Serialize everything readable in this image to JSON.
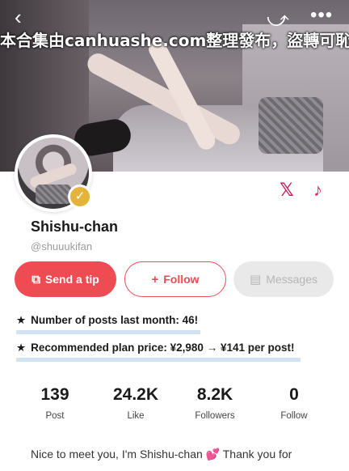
{
  "watermark": "本合集由canhuashe.com整理發布，盜轉可恥",
  "topbar": {
    "back_icon": "‹",
    "share_icon": "⤻",
    "more_icon": "•••"
  },
  "profile": {
    "name": "Shishu-chan",
    "handle": "@shuuukifan",
    "verified_icon": "✓",
    "social": {
      "x_icon": "𝕏",
      "tiktok_icon": "♪"
    }
  },
  "buttons": {
    "tip_icon": "⧉",
    "tip_label": "Send a tip",
    "follow_icon": "+",
    "follow_label": "Follow",
    "messages_icon": "▤",
    "messages_label": "Messages"
  },
  "info": {
    "star": "★",
    "posts_last_month": "Number of posts last month: 46!",
    "plan_price": "Recommended plan price: ¥2,980 → ¥141 per post!"
  },
  "stats": [
    {
      "value": "139",
      "label": "Post"
    },
    {
      "value": "24.2K",
      "label": "Like"
    },
    {
      "value": "8.2K",
      "label": "Followers"
    },
    {
      "value": "0",
      "label": "Follow"
    }
  ],
  "bio": "Nice to meet you, I'm Shishu-chan 💕 Thank you for",
  "colors": {
    "accent": "#ee4b52",
    "highlight": "#cfe3f3",
    "badge": "#e4b43a"
  }
}
